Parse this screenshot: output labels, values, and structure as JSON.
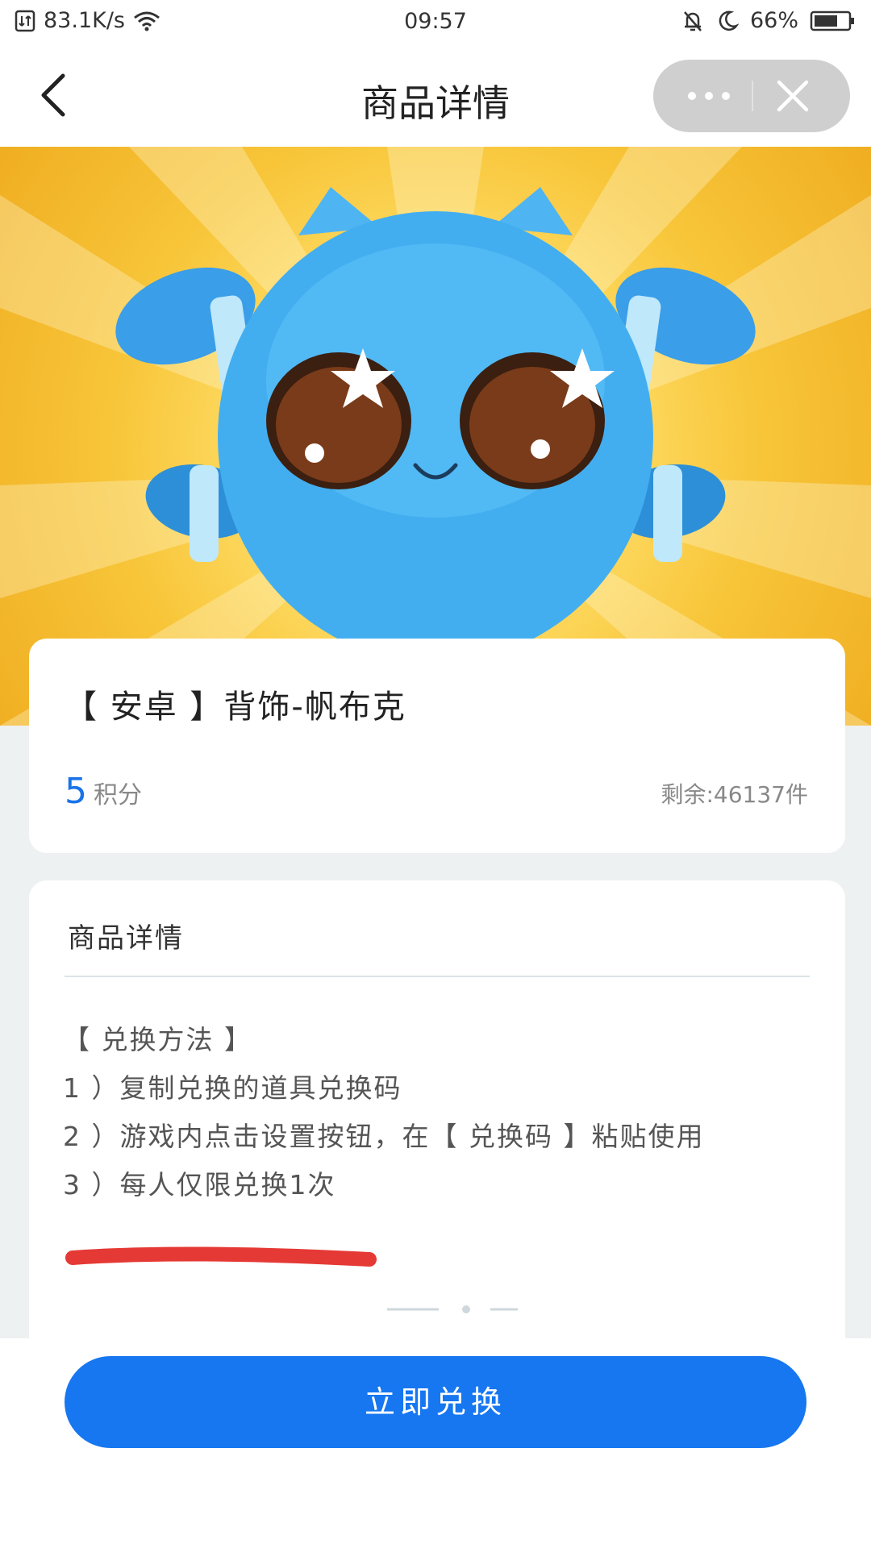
{
  "status_bar": {
    "net_speed": "83.1K/s",
    "time": "09:57",
    "battery": "66%"
  },
  "nav": {
    "title": "商品详情",
    "icons": [
      "back-arrow-icon",
      "more-dots-icon",
      "close-icon"
    ]
  },
  "hero": {
    "description": "blue cartoon pet with star eyes on yellow sunburst background"
  },
  "product": {
    "title": "【 安卓 】背饰-帆布克",
    "price_value": "5",
    "price_unit": "积分",
    "stock": "剩余:46137件"
  },
  "details": {
    "heading": "商品详情",
    "lines": [
      "【 兑换方法 】",
      "1 ）复制兑换的道具兑换码",
      "2 ）游戏内点击设置按钮，在【 兑换码 】粘贴使用",
      "3 ）每人仅限兑换1次"
    ]
  },
  "action": {
    "exchange_label": "立即兑换"
  },
  "colors": {
    "accent": "#1677f0",
    "price": "#1a73e8",
    "page_bg": "#eef1f2",
    "red_mark": "#e53935"
  }
}
